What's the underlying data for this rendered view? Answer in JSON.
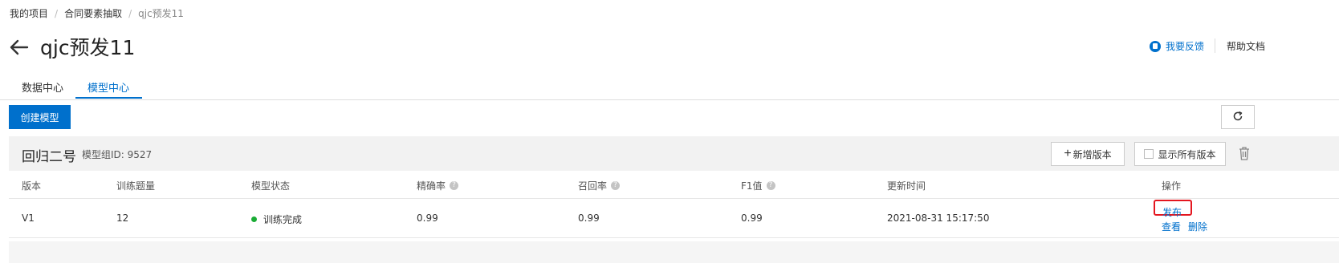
{
  "breadcrumb": {
    "items": [
      "我的项目",
      "合同要素抽取",
      "qjc预发11"
    ],
    "separator": "/"
  },
  "header": {
    "title": "qjc预发11",
    "feedback_label": "我要反馈",
    "help_label": "帮助文档"
  },
  "tabs": [
    {
      "label": "数据中心",
      "active": false
    },
    {
      "label": "模型中心",
      "active": true
    }
  ],
  "toolbar": {
    "create_label": "创建模型"
  },
  "model_group": {
    "name": "回归二号",
    "id_label": "模型组ID: 9527",
    "add_version_label": "新增版本",
    "show_all_label": "显示所有版本",
    "columns": [
      "版本",
      "训练题量",
      "模型状态",
      "精确率",
      "召回率",
      "F1值",
      "更新时间",
      "操作"
    ],
    "rows": [
      {
        "version": "V1",
        "training_count": "12",
        "status": "训练完成",
        "precision": "0.99",
        "recall": "0.99",
        "f1": "0.99",
        "updated": "2021-08-31 15:17:50",
        "actions": {
          "publish": "发布",
          "view": "查看",
          "delete": "删除"
        }
      }
    ]
  },
  "colors": {
    "accent": "#0070cc",
    "status_ok": "#1aac35",
    "highlight": "#e4161f"
  }
}
